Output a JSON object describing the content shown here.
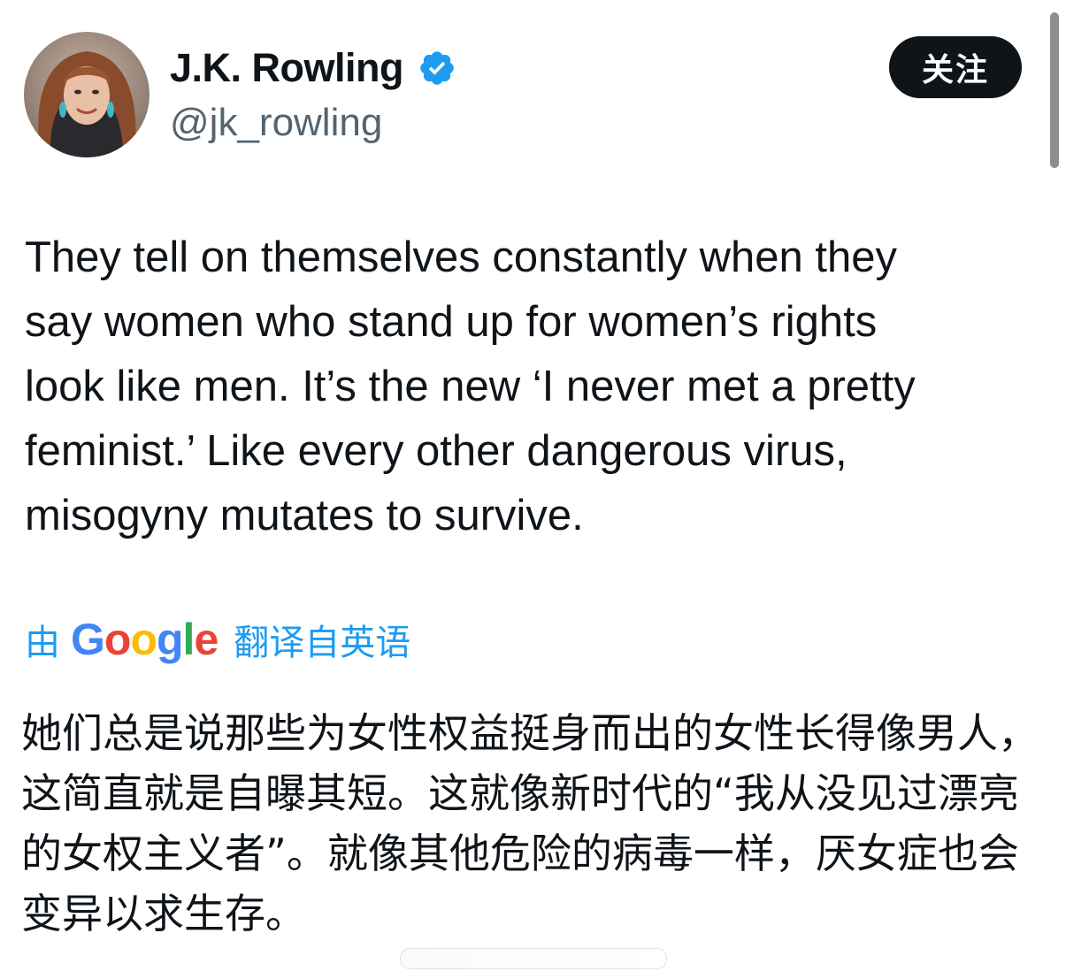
{
  "user": {
    "display_name": "J.K. Rowling",
    "handle": "@jk_rowling",
    "verified_icon": "verified-badge-icon",
    "avatar": "profile-photo"
  },
  "actions": {
    "follow_label": "关注"
  },
  "tweet": {
    "text": "They tell on themselves constantly when they\nsay women who stand up for women’s rights\nlook like men. It’s the new ‘I never met a pretty\nfeminist.’ Like every other dangerous virus,\nmisogyny mutates to survive."
  },
  "translation": {
    "prefix": "由",
    "provider": {
      "letters": [
        "G",
        "o",
        "o",
        "g",
        "l",
        "e"
      ],
      "colors": [
        "#4285f4",
        "#ea4335",
        "#fbbc05",
        "#4285f4",
        "#34a853",
        "#ea4335"
      ]
    },
    "suffix": "翻译自英语",
    "text": "她们总是说那些为女性权益挺身而出的女性长得像男人，这简直就是自曝其短。这就像新时代的“我从没见过漂亮的女权主义者”。就像其他危险的病毒一样，厌女症也会变异以求生存。"
  },
  "colors": {
    "text_primary": "#0f1419",
    "text_secondary": "#536471",
    "accent": "#1d9bf0",
    "follow_bg": "#0f1419"
  }
}
